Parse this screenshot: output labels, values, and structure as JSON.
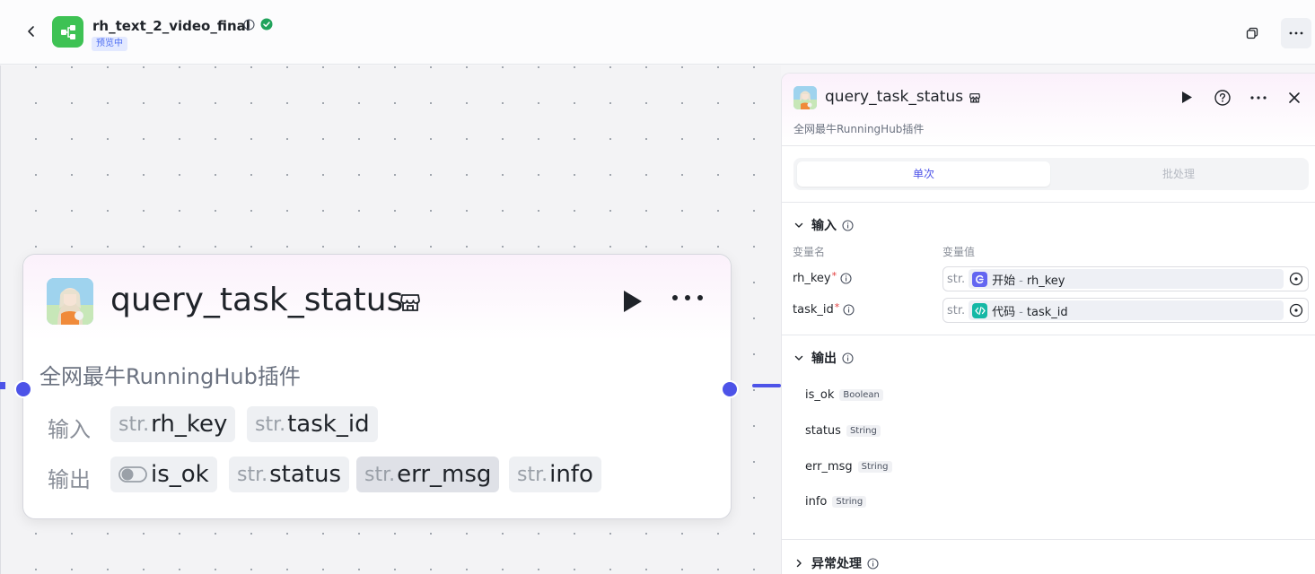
{
  "header": {
    "title": "rh_text_2_video_final",
    "badge": "预览中"
  },
  "node": {
    "title": "query_task_status",
    "description": "全网最牛RunningHub插件",
    "input_label": "输入",
    "output_label": "输出",
    "inputs": [
      {
        "prefix": "str.",
        "name": "rh_key"
      },
      {
        "prefix": "str.",
        "name": "task_id"
      }
    ],
    "outputs": [
      {
        "prefix": "",
        "name": "is_ok"
      },
      {
        "prefix": "str.",
        "name": "status"
      },
      {
        "prefix": "str.",
        "name": "err_msg"
      },
      {
        "prefix": "str.",
        "name": "info"
      }
    ]
  },
  "panel": {
    "title": "query_task_status",
    "description": "全网最牛RunningHub插件",
    "tabs": [
      "单次",
      "批处理"
    ],
    "input_section": "输入",
    "col_name": "变量名",
    "col_value": "变量值",
    "input_vars": [
      {
        "name": "rh_key",
        "required": "*",
        "prefix": "str.",
        "source": "开始",
        "sep": "-",
        "ref": "rh_key",
        "icon_color": "#6366f1"
      },
      {
        "name": "task_id",
        "required": "*",
        "prefix": "str.",
        "source": "代码",
        "sep": "-",
        "ref": "task_id",
        "icon_color": "#14b8a6"
      }
    ],
    "output_section": "输出",
    "output_vars": [
      {
        "name": "is_ok",
        "type": "Boolean"
      },
      {
        "name": "status",
        "type": "String"
      },
      {
        "name": "err_msg",
        "type": "String"
      },
      {
        "name": "info",
        "type": "String"
      }
    ],
    "error_section": "异常处理"
  },
  "colors": {
    "accent": "#4d53e8",
    "logo": "#3ec254",
    "success": "#21a35b"
  }
}
